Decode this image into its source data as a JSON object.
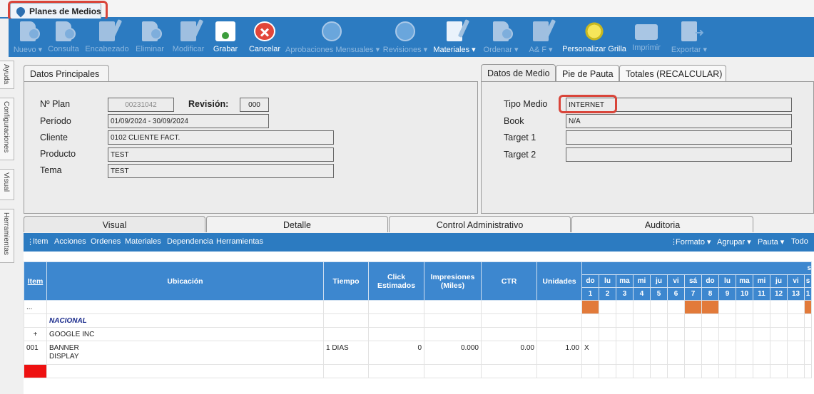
{
  "app_tab": {
    "label": "Planes de Medios"
  },
  "toolbar": [
    {
      "label": "Nuevo",
      "dropdown": true,
      "enabled": false,
      "icon": "doc-add-icon"
    },
    {
      "label": "Consulta",
      "dropdown": false,
      "enabled": false,
      "icon": "doc-question-icon"
    },
    {
      "label": "Encabezado",
      "dropdown": false,
      "enabled": false,
      "icon": "edit-header-icon"
    },
    {
      "label": "Eliminar",
      "dropdown": false,
      "enabled": false,
      "icon": "doc-delete-icon"
    },
    {
      "label": "Modificar",
      "dropdown": false,
      "enabled": false,
      "icon": "edit-icon"
    },
    {
      "label": "Grabar",
      "dropdown": false,
      "enabled": true,
      "icon": "save-icon"
    },
    {
      "label": "Cancelar",
      "dropdown": false,
      "enabled": true,
      "icon": "cancel-icon"
    },
    {
      "label": "Aprobaciones Mensuales",
      "dropdown": true,
      "enabled": false,
      "icon": "thumbs-up-icon"
    },
    {
      "label": "Revisiones",
      "dropdown": true,
      "enabled": false,
      "icon": "thumbs-up-icon"
    },
    {
      "label": "Materiales",
      "dropdown": true,
      "enabled": true,
      "icon": "materials-edit-icon"
    },
    {
      "label": "Ordenar",
      "dropdown": true,
      "enabled": false,
      "icon": "doc-add-icon"
    },
    {
      "label": "A& F",
      "dropdown": true,
      "enabled": false,
      "icon": "edit-icon"
    },
    {
      "label": "Personalizar Grilla",
      "dropdown": false,
      "enabled": true,
      "icon": "customize-grid-icon"
    },
    {
      "label": "Imprimir",
      "dropdown": false,
      "enabled": false,
      "icon": "printer-icon"
    },
    {
      "label": "Exportar",
      "dropdown": true,
      "enabled": false,
      "icon": "export-icon"
    }
  ],
  "side_tabs": [
    "Ayuda",
    "Configuraciones",
    "Visual",
    "Herramientas"
  ],
  "datos_principales": {
    "tab": "Datos Principales",
    "plan_label": "Nº Plan",
    "plan_value": "00231042",
    "revision_label": "Revisión:",
    "revision_value": "000",
    "periodo_label": "Período",
    "periodo_value": "01/09/2024 - 30/09/2024",
    "cliente_label": "Cliente",
    "cliente_value": "0102 CLIENTE FACT.",
    "producto_label": "Producto",
    "producto_value": "TEST",
    "tema_label": "Tema",
    "tema_value": "TEST"
  },
  "right_panel": {
    "tabs": [
      "Datos de Medio",
      "Pie de Pauta",
      "Totales (RECALCULAR)"
    ],
    "tipo_label": "Tipo Medio",
    "tipo_value": "INTERNET",
    "book_label": "Book",
    "book_value": "N/A",
    "target1_label": "Target 1",
    "target1_value": "",
    "target2_label": "Target 2",
    "target2_value": ""
  },
  "lower_tabs": [
    "Visual",
    "Detalle",
    "Control Administrativo",
    "Auditoria"
  ],
  "grid_menu": [
    "Item",
    "Acciones",
    "Ordenes",
    "Materiales",
    "Dependencia",
    "Herramientas"
  ],
  "grid_menu_right": [
    "Formato ▾",
    "Agrupar ▾",
    "Pauta ▾",
    "Todo"
  ],
  "table": {
    "headers": {
      "item": "Item",
      "ubicacion": "Ubicación",
      "tiempo": "Tiempo",
      "click": "Click Estimados",
      "impresiones": "Impresiones (Miles)",
      "ctr": "CTR",
      "unidades": "Unidades"
    },
    "day_names": [
      "do",
      "lu",
      "ma",
      "mi",
      "ju",
      "vi",
      "sá",
      "do",
      "lu",
      "ma",
      "mi",
      "ju",
      "vi",
      "s"
    ],
    "day_numbers": [
      "1",
      "2",
      "3",
      "4",
      "5",
      "6",
      "7",
      "8",
      "9",
      "10",
      "11",
      "12",
      "13",
      "1"
    ],
    "month_partial": "s",
    "rows": {
      "dots": "...",
      "nacional": "NACIONAL",
      "group_symbol": "+",
      "group_name": "GOOGLE INC",
      "item_code": "001",
      "item_line1": "BANNER",
      "item_line2": "DISPLAY",
      "item_tiempo": "1 DIAS",
      "item_click": "0",
      "item_impresiones": "0.000",
      "item_ctr": "0.00",
      "item_unidades": "1.00",
      "day1_mark": "X"
    }
  },
  "colors": {
    "accent": "#2c7bc1",
    "weekend": "#e27a3a",
    "highlight": "#d9453a",
    "new_row": "#ee1111"
  }
}
